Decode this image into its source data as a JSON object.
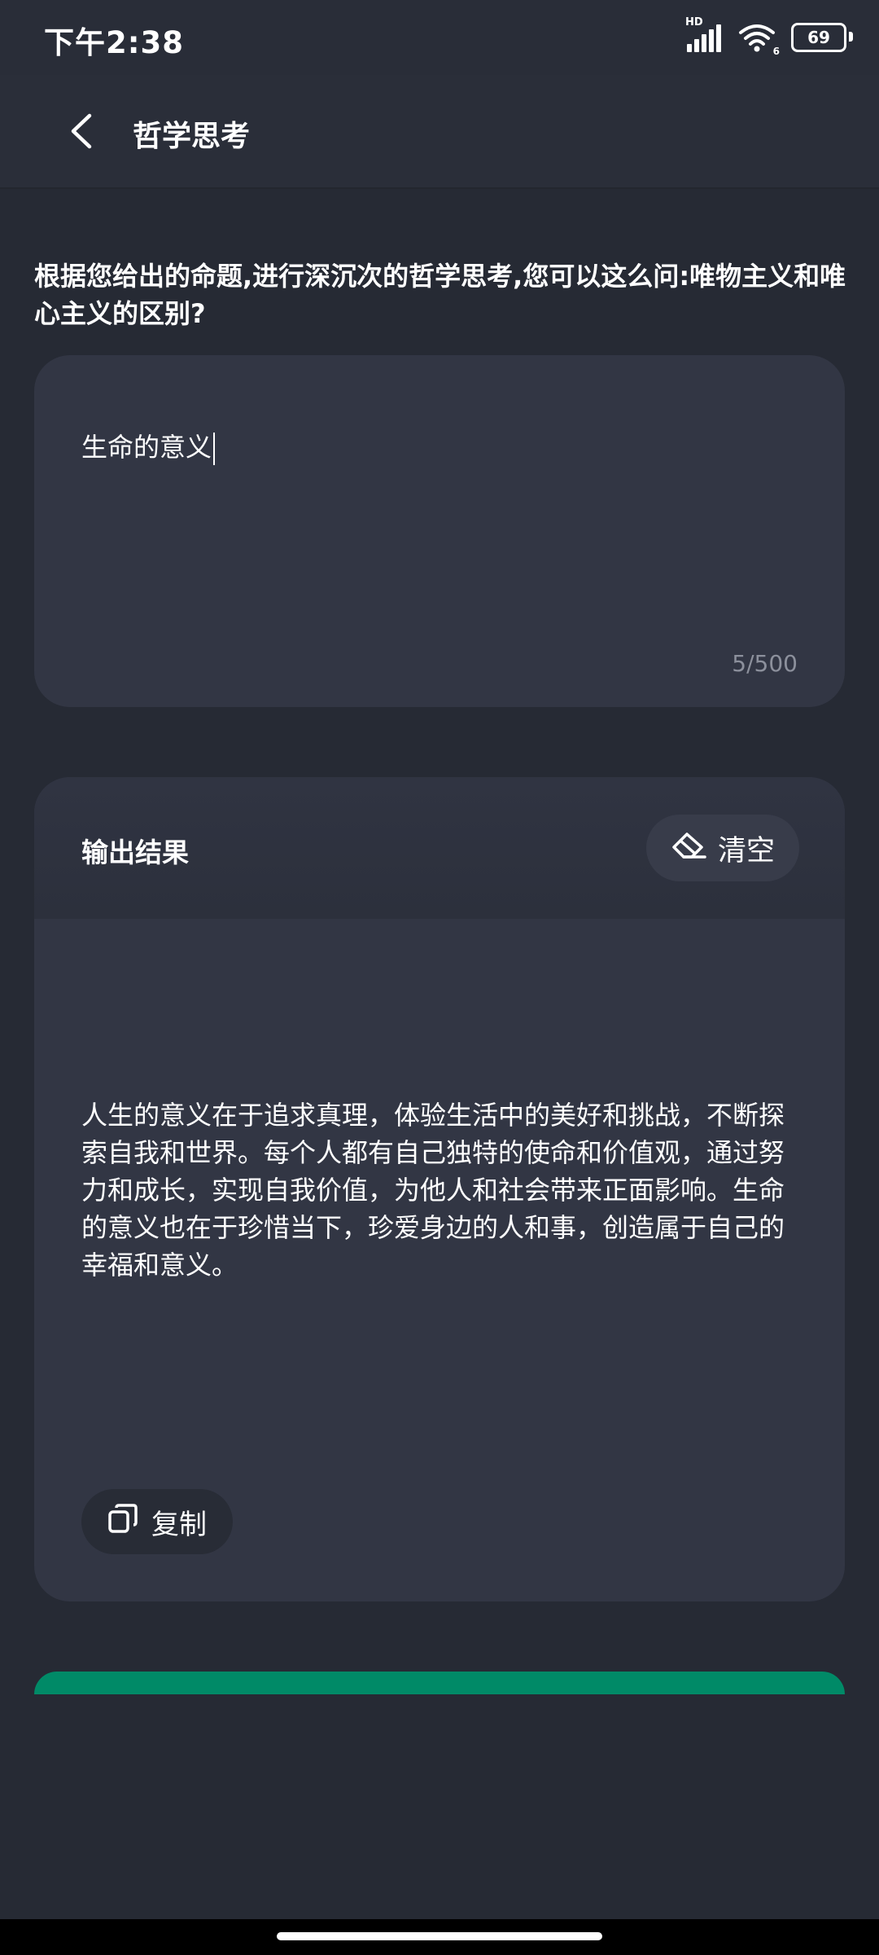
{
  "status_bar": {
    "time": "下午2:38",
    "signal_label": "HD",
    "wifi_label": "6",
    "battery": "69"
  },
  "header": {
    "title": "哲学思考"
  },
  "description": "根据您给出的命题,进行深沉次的哲学思考,您可以这么问:唯物主义和唯心主义的区别?",
  "input": {
    "value": "生命的意义",
    "counter": "5/500"
  },
  "output": {
    "title": "输出结果",
    "clear_label": "清空",
    "text": "人生的意义在于追求真理，体验生活中的美好和挑战，不断探索自我和世界。每个人都有自己独特的使命和价值观，通过努力和成长，实现自我价值，为他人和社会带来正面影响。生命的意义也在于珍惜当下，珍爱身边的人和事，创造属于自己的幸福和意义。",
    "copy_label": "复制"
  },
  "colors": {
    "background": "#262a34",
    "card": "#323644",
    "accent": "#008a67"
  }
}
